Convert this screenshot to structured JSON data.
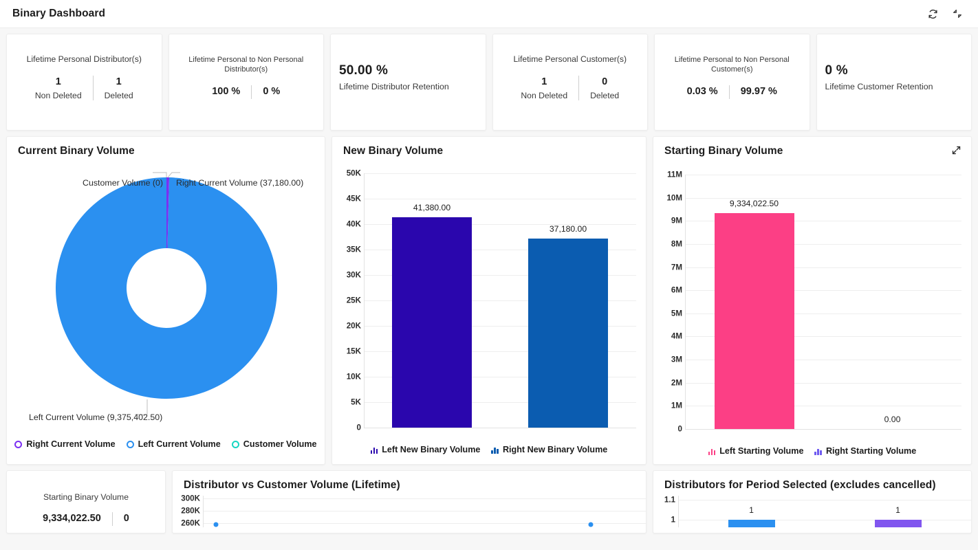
{
  "header": {
    "title": "Binary Dashboard",
    "refresh_icon": "refresh-icon",
    "collapse_icon": "collapse-icon"
  },
  "kpis": [
    {
      "title": "Lifetime Personal Distributor(s)",
      "layout": "split",
      "left_value": "1",
      "left_label": "Non Deleted",
      "right_value": "1",
      "right_label": "Deleted"
    },
    {
      "title": "Lifetime Personal to Non Personal Distributor(s)",
      "layout": "split-small",
      "left_value": "100 %",
      "left_label": "",
      "right_value": "0 %",
      "right_label": ""
    },
    {
      "title": "Lifetime Distributor Retention",
      "layout": "big",
      "big_value": "50.00 %"
    },
    {
      "title": "Lifetime Personal Customer(s)",
      "layout": "split",
      "left_value": "1",
      "left_label": "Non Deleted",
      "right_value": "0",
      "right_label": "Deleted"
    },
    {
      "title": "Lifetime Personal to Non Personal Customer(s)",
      "layout": "split-small",
      "left_value": "0.03 %",
      "left_label": "",
      "right_value": "99.97 %",
      "right_label": ""
    },
    {
      "title": "Lifetime Customer Retention",
      "layout": "big",
      "big_value": "0 %"
    }
  ],
  "panels": {
    "current_binary_volume": {
      "title": "Current Binary Volume",
      "label_customer": "Customer Volume (0)",
      "label_right": "Right Current Volume (37,180.00)",
      "label_left": "Left Current Volume (9,375,402.50)",
      "legend": [
        {
          "label": "Right Current Volume",
          "color": "#7B2FF2"
        },
        {
          "label": "Left Current Volume",
          "color": "#2B90F0"
        },
        {
          "label": "Customer Volume",
          "color": "#16D6C2"
        }
      ]
    },
    "new_binary_volume": {
      "title": "New Binary Volume",
      "legend": [
        {
          "label": "Left New Binary Volume",
          "color": "#2A06AD"
        },
        {
          "label": "Right New Binary Volume",
          "color": "#0B5CB0"
        }
      ]
    },
    "starting_binary_volume": {
      "title": "Starting Binary Volume",
      "expand_icon": "expand-icon",
      "legend": [
        {
          "label": "Left Starting Volume",
          "color": "#FC3F85"
        },
        {
          "label": "Right Starting Volume",
          "color": "#6F5BF0"
        }
      ]
    },
    "starting_binary_volume_kpi": {
      "title": "Starting Binary Volume",
      "left_value": "9,334,022.50",
      "right_value": "0"
    },
    "distributor_vs_customer": {
      "title": "Distributor vs Customer Volume (Lifetime)"
    },
    "distributors_period": {
      "title": "Distributors for Period Selected (excludes cancelled)"
    }
  },
  "chart_data": [
    {
      "id": "current-binary-volume",
      "type": "pie",
      "title": "Current Binary Volume",
      "variant": "donut",
      "labels": [
        "Right Current Volume",
        "Left Current Volume",
        "Customer Volume"
      ],
      "values": [
        37180.0,
        9375402.5,
        0
      ],
      "value_labels": [
        "37,180.00",
        "9,375,402.50",
        "0"
      ],
      "colors": [
        "#7B2FF2",
        "#2B90F0",
        "#16D6C2"
      ],
      "legend_position": "bottom"
    },
    {
      "id": "new-binary-volume",
      "type": "bar",
      "title": "New Binary Volume",
      "categories": [
        "Left New Binary Volume",
        "Right New Binary Volume"
      ],
      "values": [
        41380.0,
        37180.0
      ],
      "value_labels": [
        "41,380.00",
        "37,180.00"
      ],
      "colors": [
        "#2A06AD",
        "#0B5CB0"
      ],
      "ylim": [
        0,
        50000
      ],
      "ytick_values": [
        0,
        5000,
        10000,
        15000,
        20000,
        25000,
        30000,
        35000,
        40000,
        45000,
        50000
      ],
      "ytick_labels": [
        "0",
        "5K",
        "10K",
        "15K",
        "20K",
        "25K",
        "30K",
        "35K",
        "40K",
        "45K",
        "50K"
      ],
      "xlabel": "",
      "ylabel": "",
      "grid": true,
      "legend_position": "bottom"
    },
    {
      "id": "starting-binary-volume",
      "type": "bar",
      "title": "Starting Binary Volume",
      "categories": [
        "Left Starting Volume",
        "Right Starting Volume"
      ],
      "values": [
        9334022.5,
        0.0
      ],
      "value_labels": [
        "9,334,022.50",
        "0.00"
      ],
      "colors": [
        "#FC3F85",
        "#6F5BF0"
      ],
      "ylim": [
        0,
        11000000
      ],
      "ytick_values": [
        0,
        1000000,
        2000000,
        3000000,
        4000000,
        5000000,
        6000000,
        7000000,
        8000000,
        9000000,
        10000000,
        11000000
      ],
      "ytick_labels": [
        "0",
        "1M",
        "2M",
        "3M",
        "4M",
        "5M",
        "6M",
        "7M",
        "8M",
        "9M",
        "10M",
        "11M"
      ],
      "xlabel": "",
      "ylabel": "",
      "grid": true,
      "legend_position": "bottom"
    },
    {
      "id": "distributor-vs-customer-volume",
      "type": "scatter",
      "title": "Distributor vs Customer Volume (Lifetime)",
      "ytick_labels": [
        "260K",
        "280K",
        "300K"
      ],
      "ytick_values": [
        260000,
        280000,
        300000
      ],
      "points": [
        {
          "x": 0.02,
          "y": 258000,
          "color": "#2B90F0"
        },
        {
          "x": 0.88,
          "y": 259000,
          "color": "#2B90F0"
        }
      ],
      "grid": true
    },
    {
      "id": "distributors-for-period-selected",
      "type": "bar",
      "title": "Distributors for Period Selected (excludes cancelled)",
      "categories": [
        "",
        ""
      ],
      "values": [
        1,
        1
      ],
      "value_labels": [
        "1",
        "1"
      ],
      "colors": [
        "#2B90F0",
        "#8156EF"
      ],
      "ylim": [
        0,
        1.1
      ],
      "ytick_values": [
        1,
        1.1
      ],
      "ytick_labels": [
        "1",
        "1.1"
      ],
      "grid": true
    }
  ]
}
